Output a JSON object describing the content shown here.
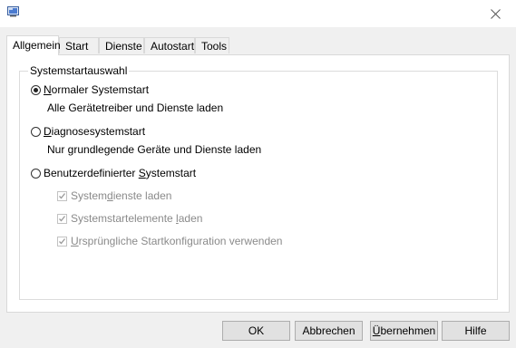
{
  "window": {
    "icon": "msconfig-app-icon"
  },
  "tabs": [
    {
      "label": "Allgemein",
      "active": true
    },
    {
      "label": "Start",
      "active": false
    },
    {
      "label": "Dienste",
      "active": false
    },
    {
      "label": "Autostart",
      "active": false
    },
    {
      "label": "Tools",
      "active": false
    }
  ],
  "group": {
    "title": "Systemstartauswahl"
  },
  "options": {
    "normal": {
      "label_u": "N",
      "label_rest": "ormaler Systemstart",
      "description": "Alle Gerätetreiber und Dienste laden",
      "selected": true
    },
    "diagnostic": {
      "label_u": "D",
      "label_rest": "iagnosesystemstart",
      "description": "Nur grundlegende Geräte und Dienste laden",
      "selected": false
    },
    "custom": {
      "label_pre": "Benutzerdefinierter ",
      "label_u": "S",
      "label_rest": "ystemstart",
      "selected": false
    }
  },
  "checkboxes": {
    "services": {
      "pre": "System",
      "u": "d",
      "post": "ienste laden",
      "checked": true,
      "enabled": false
    },
    "startup_items": {
      "pre": "Systemstartelemente ",
      "u": "l",
      "post": "aden",
      "checked": true,
      "enabled": false
    },
    "original_config": {
      "pre": "",
      "u": "U",
      "post": "rsprüngliche Startkonfiguration verwenden",
      "checked": true,
      "enabled": false
    }
  },
  "buttons": {
    "ok": "OK",
    "cancel": "Abbrechen",
    "apply_u": "Ü",
    "apply_rest": "bernehmen",
    "help": "Hilfe"
  },
  "colors": {
    "window_bg": "#f0f0f0",
    "panel_bg": "#ffffff",
    "disabled_text": "#8a8a8a",
    "button_bg": "#e1e1e1"
  }
}
